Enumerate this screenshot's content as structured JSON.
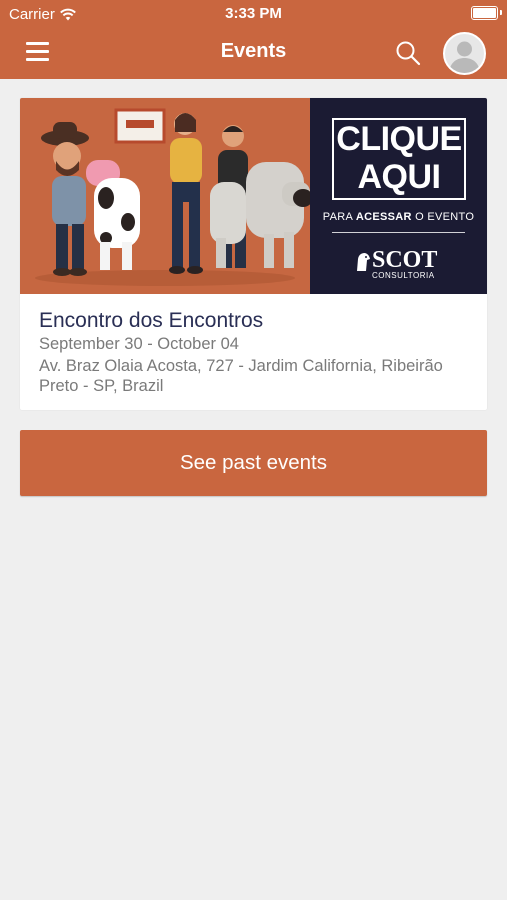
{
  "status_bar": {
    "carrier": "Carrier",
    "time": "3:33 PM"
  },
  "header": {
    "title": "Events",
    "menu_icon": "hamburger-menu-icon",
    "search_icon": "search-icon",
    "avatar_icon": "user-avatar-icon"
  },
  "event": {
    "banner": {
      "headline_1": "CLIQUE",
      "headline_2": "AQUI",
      "sub_pre": "PARA ",
      "sub_bold": "ACESSAR",
      "sub_post": " O EVENTO",
      "brand": "SCOT",
      "brand_sub": "CONSULTORIA"
    },
    "name": "Encontro dos Encontros",
    "dates": "September 30 - October 04",
    "address": "Av. Braz Olaia Acosta, 727 - Jardim California, Ribeirão Preto - SP, Brazil"
  },
  "past_events_button": "See past events",
  "colors": {
    "brand": "#c9663f",
    "background": "#efefef",
    "event_title": "#2a2f55",
    "muted_text": "#7a7a7a",
    "banner_dark": "#1b1b33"
  }
}
